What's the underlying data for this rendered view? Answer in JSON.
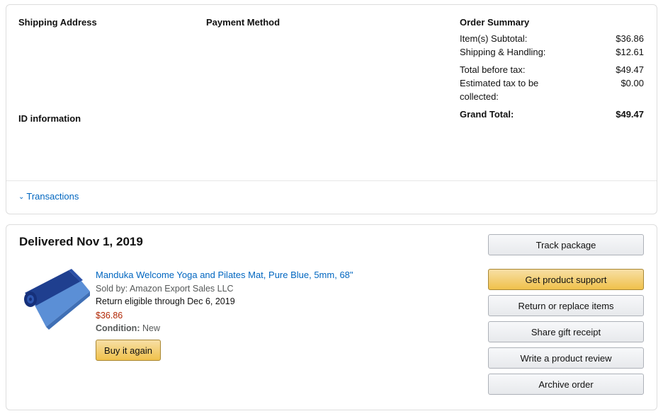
{
  "order_info": {
    "shipping_address_label": "Shipping Address",
    "payment_method_label": "Payment Method",
    "id_information_label": "ID information",
    "summary": {
      "title": "Order Summary",
      "subtotal_label": "Item(s) Subtotal:",
      "subtotal_value": "$36.86",
      "shipping_label": "Shipping & Handling:",
      "shipping_value": "$12.61",
      "before_tax_label": "Total before tax:",
      "before_tax_value": "$49.47",
      "est_tax_label_line1": "Estimated tax to be",
      "est_tax_label_line2": "collected:",
      "est_tax_value": "$0.00",
      "grand_total_label": "Grand Total:",
      "grand_total_value": "$49.47"
    },
    "transactions_label": "Transactions"
  },
  "shipment": {
    "status": "Delivered Nov 1, 2019",
    "item": {
      "title": "Manduka Welcome Yoga and Pilates Mat, Pure Blue, 5mm, 68\"",
      "sold_by": "Sold by: Amazon Export Sales LLC",
      "return_eligible": "Return eligible through Dec 6, 2019",
      "price": "$36.86",
      "condition_label": "Condition:",
      "condition_value": "New",
      "buy_again_label": "Buy it again",
      "image_icon": "yoga-mat-image"
    },
    "actions": {
      "track": "Track package",
      "support": "Get product support",
      "return": "Return or replace items",
      "gift": "Share gift receipt",
      "review": "Write a product review",
      "archive": "Archive order"
    }
  },
  "colors": {
    "link": "#0066c0",
    "price": "#b12704",
    "primary_button": "#f0c14b",
    "border": "#dddddd"
  }
}
